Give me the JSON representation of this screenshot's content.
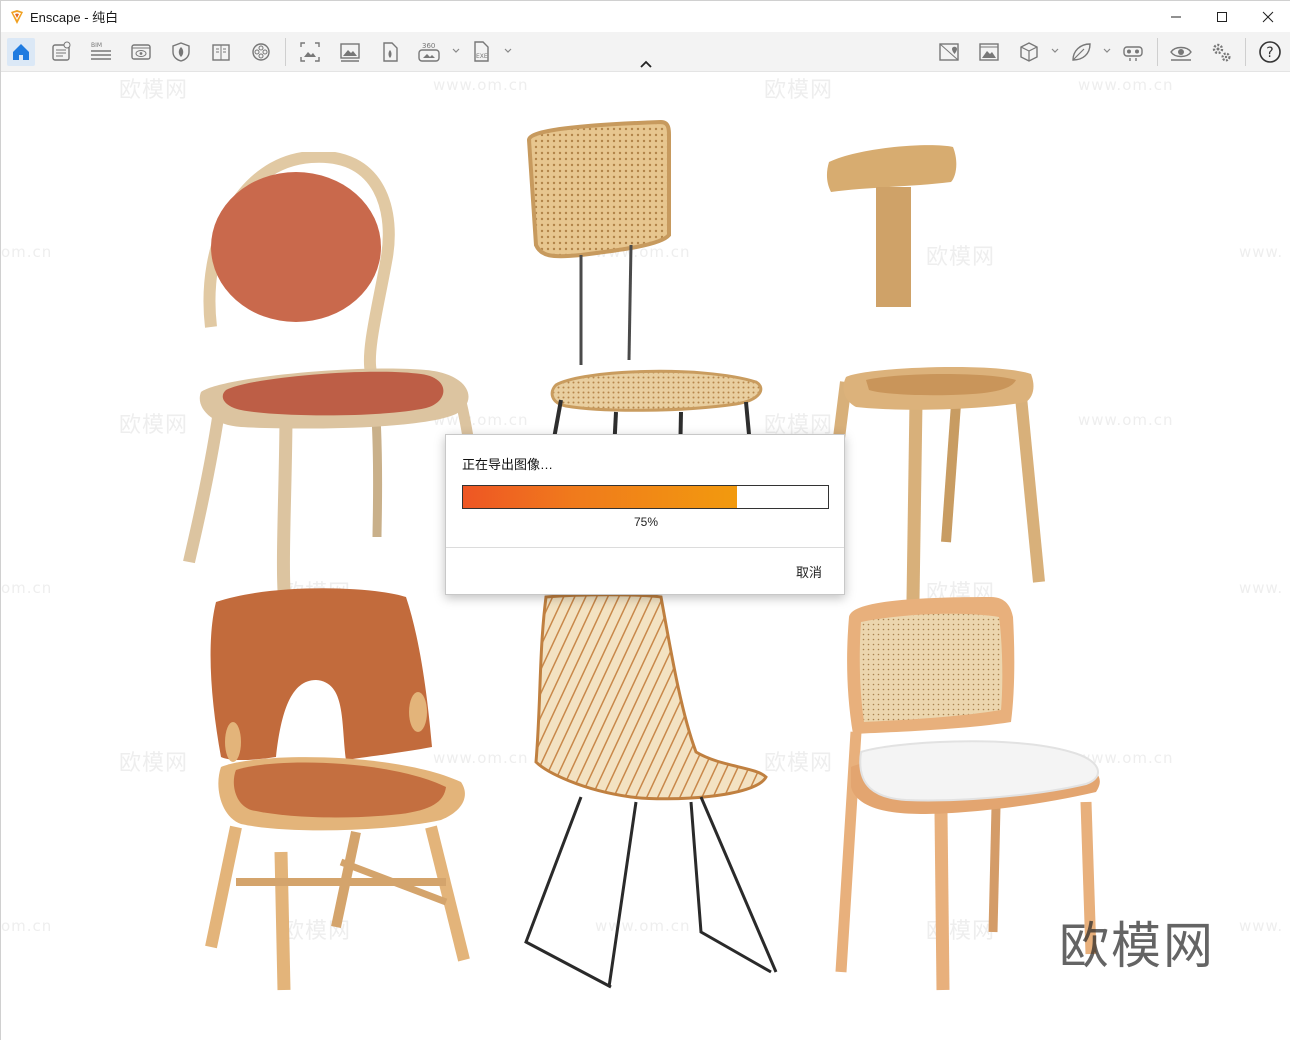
{
  "window": {
    "title": "Enscape - 纯白"
  },
  "toolbar": {
    "items": [
      {
        "icon": "home-icon"
      },
      {
        "icon": "document-settings-icon"
      },
      {
        "icon": "bim-icon",
        "label": "BIM"
      },
      {
        "icon": "view-eye-icon"
      },
      {
        "icon": "shield-icon"
      },
      {
        "icon": "book-icon"
      },
      {
        "icon": "film-reel-icon"
      },
      {
        "icon": "screenshot-icon"
      },
      {
        "icon": "image-gallery-icon"
      },
      {
        "icon": "file-export-icon"
      },
      {
        "icon": "panorama-360-icon",
        "label": "360"
      },
      {
        "icon": "exe-export-icon",
        "label": "EXE"
      },
      {
        "icon": "map-marker-icon"
      },
      {
        "icon": "image-frame-icon"
      },
      {
        "icon": "cube-icon"
      },
      {
        "icon": "leaf-icon"
      },
      {
        "icon": "vr-headset-icon"
      },
      {
        "icon": "eye-visibility-icon"
      },
      {
        "icon": "settings-gears-icon"
      },
      {
        "icon": "help-icon",
        "label": "?"
      }
    ]
  },
  "watermark": {
    "text": "欧模网",
    "url": "www.om.cn",
    "url_partial": "om.cn",
    "url_partial_right": "www."
  },
  "dialog": {
    "title": "正在导出图像…",
    "progress_value": 0.75,
    "progress_label": "75%",
    "cancel_label": "取消"
  },
  "colors": {
    "accent": "#1f7be0",
    "progress_start": "#ee5624",
    "progress_end": "#f29a0e"
  }
}
